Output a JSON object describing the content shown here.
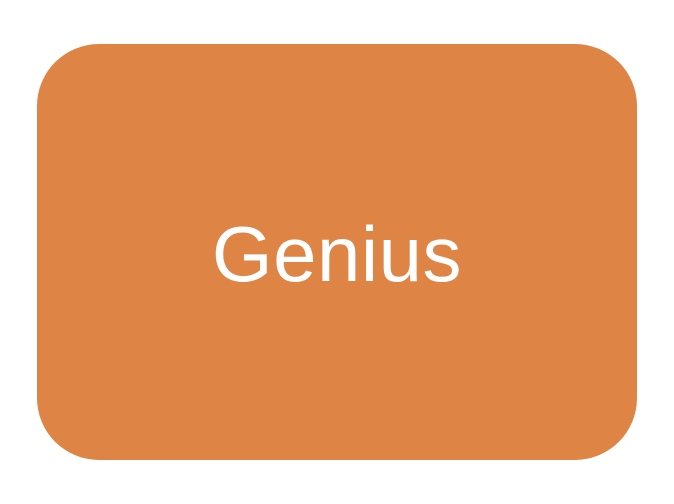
{
  "shape": {
    "label": "Genius",
    "fill_color": "#DE8444",
    "text_color": "#FFFFFF"
  }
}
